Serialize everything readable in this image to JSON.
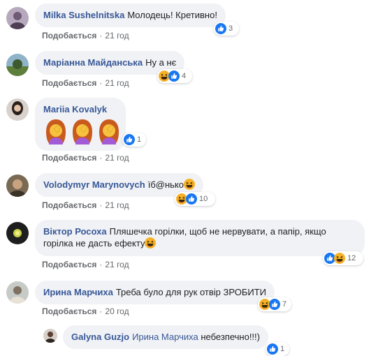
{
  "comments": [
    {
      "author": "Milka Sushelnitska",
      "text": "Молодець! Кретивно!",
      "like": "Подобається",
      "time": "21 год",
      "reactions": {
        "count": "3",
        "icons": [
          "like-icon"
        ]
      }
    },
    {
      "author": "Маріанна Майданська",
      "text": "Ну а нє",
      "like": "Подобається",
      "time": "21 год",
      "reactions": {
        "count": "4",
        "icons": [
          "haha-icon",
          "like-icon"
        ]
      }
    },
    {
      "author": "Mariia Kovalyk",
      "text": "",
      "emoji": "🤦‍♀️🤦‍♀️🤦‍♀️",
      "like": "Подобається",
      "time": "21 год",
      "reactions": {
        "count": "1",
        "icons": [
          "like-icon"
        ]
      }
    },
    {
      "author": "Volodymyr Marynovych",
      "text": "їб@нько",
      "like": "Подобається",
      "time": "21 год",
      "reactions": {
        "count": "10",
        "icons": [
          "haha-icon",
          "like-icon"
        ]
      }
    },
    {
      "author": "Віктор Росоха",
      "text": "Пляшечка горілки, щоб не нервувати, а папір, якщо горілка не дасть ефекту",
      "like": "Подобається",
      "time": "21 год",
      "reactions": {
        "count": "12",
        "icons": [
          "like-icon",
          "haha-icon"
        ]
      }
    },
    {
      "author": "Ирина Марчиха",
      "text": "Треба було для рук отвір ЗРОБИТИ",
      "like": "Подобається",
      "time": "20 год",
      "reactions": {
        "count": "7",
        "icons": [
          "haha-icon",
          "like-icon"
        ]
      }
    },
    {
      "author": "Galyna Guzjo",
      "mention": "Ирина Марчиха",
      "text": "небезпечно!!!)",
      "reactions": {
        "count": "1",
        "icons": [
          "like-icon"
        ]
      }
    }
  ],
  "separator": "·",
  "colors": {
    "link": "#385898",
    "bubble": "#f0f2f5",
    "meta": "#65676b",
    "like_blue": "#1877f2",
    "haha_yellow": "#f7b125"
  }
}
